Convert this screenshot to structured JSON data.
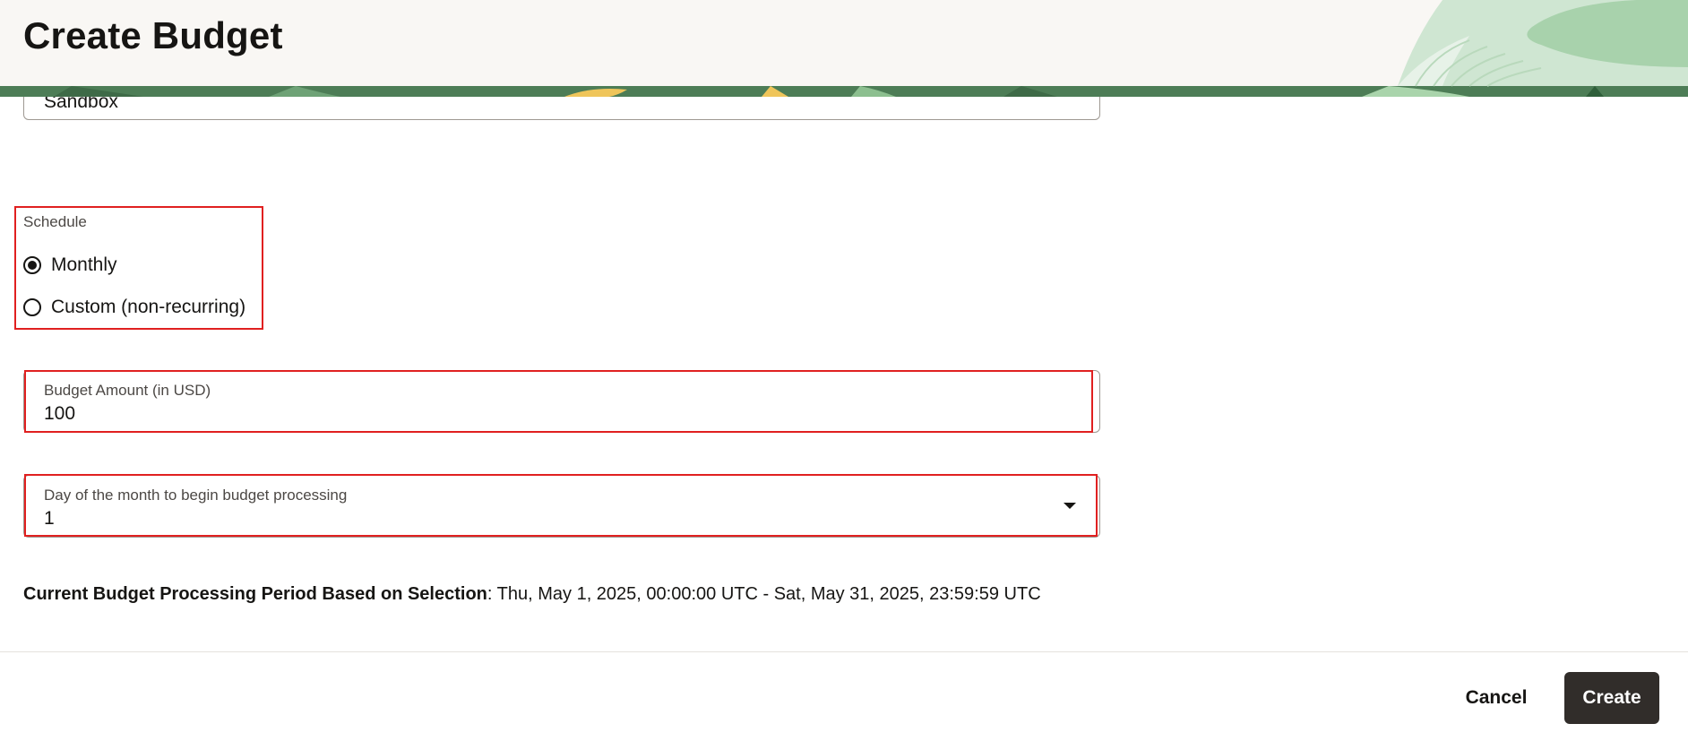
{
  "header": {
    "title": "Create Budget"
  },
  "compartment": {
    "value": "Sandbox"
  },
  "schedule": {
    "label": "Schedule",
    "options": [
      {
        "label": "Monthly",
        "selected": true
      },
      {
        "label": "Custom (non-recurring)",
        "selected": false
      }
    ]
  },
  "budget_amount": {
    "label": "Budget Amount (in USD)",
    "value": "100"
  },
  "processing_day": {
    "label": "Day of the month to begin budget processing",
    "value": "1"
  },
  "processing_period": {
    "label": "Current Budget Processing Period Based on Selection",
    "separator": ":",
    "value": " Thu, May 1, 2025, 00:00:00 UTC - Sat, May 31, 2025, 23:59:59 UTC"
  },
  "footer": {
    "cancel_label": "Cancel",
    "create_label": "Create"
  },
  "colors": {
    "highlight": "#e02020",
    "primary_button": "#312d2a",
    "banner_green": "#4d7d56"
  }
}
